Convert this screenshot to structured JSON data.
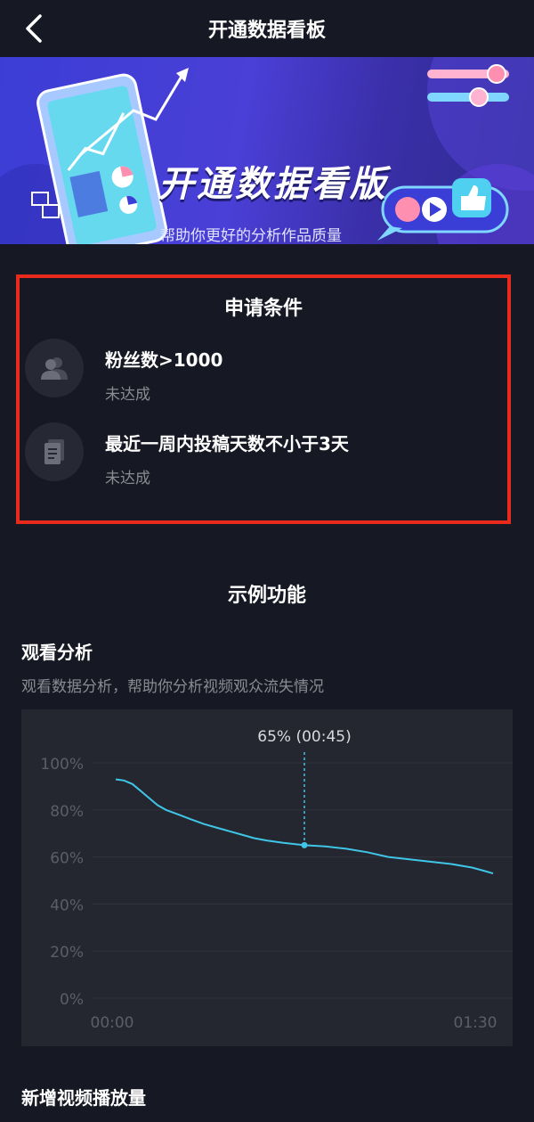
{
  "header": {
    "title": "开通数据看板"
  },
  "banner": {
    "title": "开通数据看版",
    "subtitle": "帮助你更好的分析作品质量"
  },
  "conditions": {
    "title": "申请条件",
    "items": [
      {
        "label": "粉丝数>1000",
        "status": "未达成"
      },
      {
        "label": "最近一周内投稿天数不小于3天",
        "status": "未达成"
      }
    ]
  },
  "examples": {
    "title": "示例功能",
    "watch_analysis": {
      "title": "观看分析",
      "description": "观看数据分析，帮助你分析视频观众流失情况"
    },
    "new_plays": {
      "title": "新增视频播放量"
    }
  },
  "colors": {
    "background": "#161823",
    "accent_line": "#3fc6e6",
    "highlight_border": "#e82a1c",
    "banner_blue": "#3b3ed6"
  },
  "chart_data": {
    "type": "line",
    "title": "",
    "xlabel": "",
    "ylabel": "",
    "x_tick_labels": [
      "00:00",
      "01:30"
    ],
    "y_tick_labels": [
      "100%",
      "80%",
      "60%",
      "40%",
      "20%",
      "0%"
    ],
    "xlim": [
      0,
      90
    ],
    "ylim": [
      0,
      100
    ],
    "grid": true,
    "annotation": {
      "label": "65% (00:45)",
      "x": 45,
      "y": 65
    },
    "series": [
      {
        "x": [
          0,
          2,
          4,
          6,
          8,
          10,
          12,
          15,
          18,
          21,
          24,
          27,
          30,
          33,
          36,
          40,
          45,
          50,
          55,
          60,
          65,
          70,
          75,
          80,
          85,
          88,
          90
        ],
        "y": [
          93,
          92.5,
          91,
          88,
          85,
          82,
          80,
          78,
          76,
          74,
          72.5,
          71,
          69.5,
          68,
          67,
          66,
          65,
          64.5,
          63.5,
          62,
          60,
          59,
          58,
          57,
          55.5,
          54,
          53
        ]
      }
    ]
  }
}
